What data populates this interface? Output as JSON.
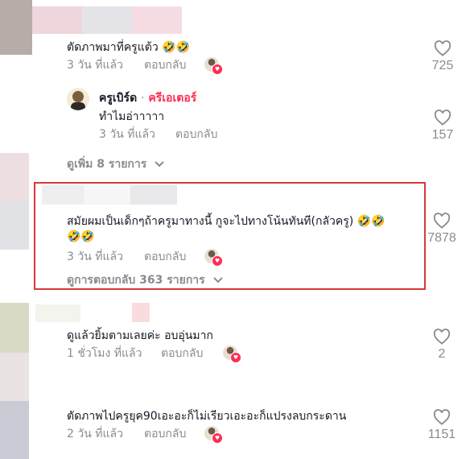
{
  "comments": [
    {
      "text": "ตัดภาพมาที่ครูแต้ว 🤣🤣",
      "time": "3 วัน ที่แล้ว",
      "reply": "ตอบกลับ",
      "likes": "725"
    },
    {
      "author": "ครูเบิร์ด",
      "separator": "·",
      "creator_tag": "ครีเอเตอร์",
      "text": "ทำไมอ่าาาาา",
      "time": "3 วัน ที่แล้ว",
      "reply": "ตอบกลับ",
      "likes": "157"
    },
    {
      "view_more": "ดูเพิ่ม 8 รายการ"
    },
    {
      "text_line1": "สมัยผมเป็นเด็กๆถ้าครูมาทางนี้ กูจะไปทางโน้นทันที(กลัวครู) 🤣🤣",
      "text_line2": "🤣🤣",
      "time": "3 วัน ที่แล้ว",
      "reply": "ตอบกลับ",
      "likes": "7878",
      "view_replies": "ดูการตอบกลับ 363 รายการ"
    },
    {
      "text": "ดูแล้วยิ้มตามเลยค่ะ อบอุ่นมาก",
      "time": "1 ชั่วโมง ที่แล้ว",
      "reply": "ตอบกลับ",
      "likes": "2"
    },
    {
      "text": "ตัดภาพไปครูยุค90เอะอะก็ไม่เรียวเอะอะก็แปรงลบกระดาน",
      "time": "2 วัน ที่แล้ว",
      "reply": "ตอบกลับ",
      "likes": "1151"
    }
  ],
  "colors": {
    "accent_red": "#fe2c55",
    "highlight_border": "#d8393b",
    "muted": "#8a8b91"
  }
}
